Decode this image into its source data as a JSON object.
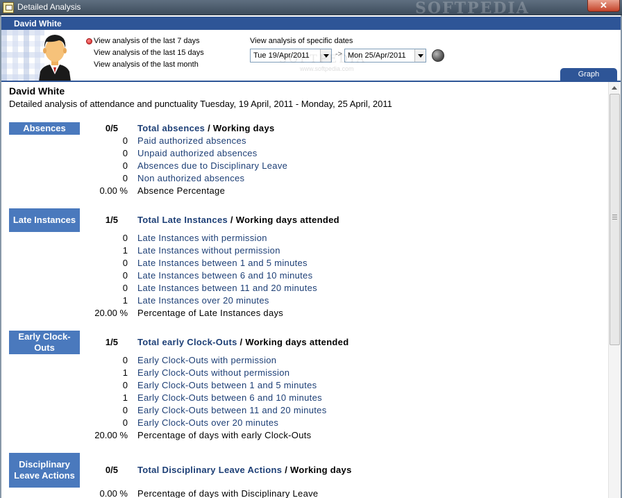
{
  "window": {
    "title": "Detailed Analysis",
    "watermark": "SOFTPEDIA",
    "close_symbol": "✕"
  },
  "header": {
    "user_name": "David White",
    "radio_options": [
      {
        "label": "View analysis of the last 7 days",
        "selected": true
      },
      {
        "label": "View analysis of the last 15 days",
        "selected": false
      },
      {
        "label": "View analysis of the last month",
        "selected": false
      }
    ],
    "dates_label": "View analysis of specific dates",
    "date_from": "Tue 19/Apr/2011",
    "date_to": "Mon 25/Apr/2011",
    "range_arrow": "->",
    "graph_tab": "Graph",
    "watermark": "SOFTPEDIA",
    "watermark_url": "www.softpedia.com"
  },
  "report": {
    "name": "David White",
    "description": "Detailed analysis of attendance and punctuality Tuesday, 19 April, 2011 - Monday, 25 April, 2011",
    "sections": [
      {
        "label": "Absences",
        "total_value": "0/5",
        "total_link": "Total absences",
        "total_rest": " / Working days",
        "rows": [
          {
            "value": "0",
            "label": "Paid authorized absences"
          },
          {
            "value": "0",
            "label": "Unpaid authorized absences"
          },
          {
            "value": "0",
            "label": "Absences due to Disciplinary Leave"
          },
          {
            "value": "0",
            "label": "Non authorized absences"
          },
          {
            "value": "0.00 %",
            "label": "Absence Percentage"
          }
        ]
      },
      {
        "label": "Late Instances",
        "total_value": "1/5",
        "total_link": "Total Late Instances",
        "total_rest": " / Working days attended",
        "rows": [
          {
            "value": "0",
            "label": "Late Instances with permission"
          },
          {
            "value": "1",
            "label": "Late Instances without permission"
          },
          {
            "value": "0",
            "label": "Late Instances between 1 and 5 minutes"
          },
          {
            "value": "0",
            "label": "Late Instances between 6 and 10 minutes"
          },
          {
            "value": "0",
            "label": "Late Instances between 11 and 20 minutes"
          },
          {
            "value": "1",
            "label": "Late Instances over 20 minutes"
          },
          {
            "value": "20.00 %",
            "label": "Percentage of Late Instances days"
          }
        ]
      },
      {
        "label": "Early Clock-Outs",
        "total_value": "1/5",
        "total_link": "Total early Clock-Outs",
        "total_rest": " / Working days attended",
        "rows": [
          {
            "value": "0",
            "label": "Early Clock-Outs with permission"
          },
          {
            "value": "1",
            "label": "Early Clock-Outs without permission"
          },
          {
            "value": "0",
            "label": "Early Clock-Outs between 1 and 5 minutes"
          },
          {
            "value": "1",
            "label": "Early Clock-Outs between 6 and 10 minutes"
          },
          {
            "value": "0",
            "label": "Early Clock-Outs between 11 and 20 minutes"
          },
          {
            "value": "0",
            "label": "Early Clock-Outs over 20 minutes"
          },
          {
            "value": "20.00 %",
            "label": "Percentage of days with early Clock-Outs"
          }
        ]
      },
      {
        "label": "Disciplinary Leave Actions",
        "total_value": "0/5",
        "total_link": "Total Disciplinary Leave Actions",
        "total_rest": " / Working days",
        "rows": [
          {
            "value": "0.00 %",
            "label": "Percentage of days with Disciplinary Leave"
          }
        ]
      }
    ]
  },
  "colors": {
    "accent": "#2e5597",
    "section_label_bg": "#4a79bd",
    "link_text": "#1d3f76"
  }
}
